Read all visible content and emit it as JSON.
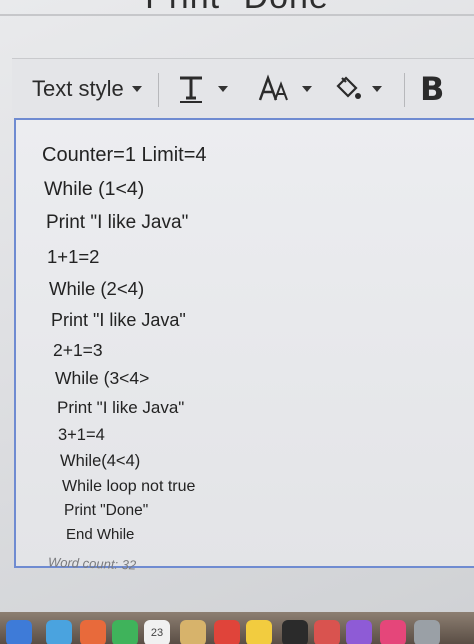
{
  "header": {
    "title": "Print \"Done"
  },
  "toolbar": {
    "text_style_label": "Text style",
    "font_icon": "text-format-icon",
    "size_icon": "font-size-icon",
    "fill_icon": "paint-bucket-icon",
    "bold_label": "B"
  },
  "editor": {
    "lines": [
      "Counter=1 Limit=4",
      "While (1<4)",
      "Print \"I like Java\"",
      "1+1=2",
      "While (2<4)",
      "Print \"I like Java\"",
      "2+1=3",
      "While (3<4>",
      "Print \"I like Java\"",
      "3+1=4",
      "While(4<4)",
      "While loop not true",
      "Print \"Done\"",
      "End While"
    ]
  },
  "footer": {
    "word_count": "Word count: 32"
  },
  "dock": {
    "calendar_day": "23"
  },
  "colors": {
    "editor_border": "#6f8bd1"
  }
}
